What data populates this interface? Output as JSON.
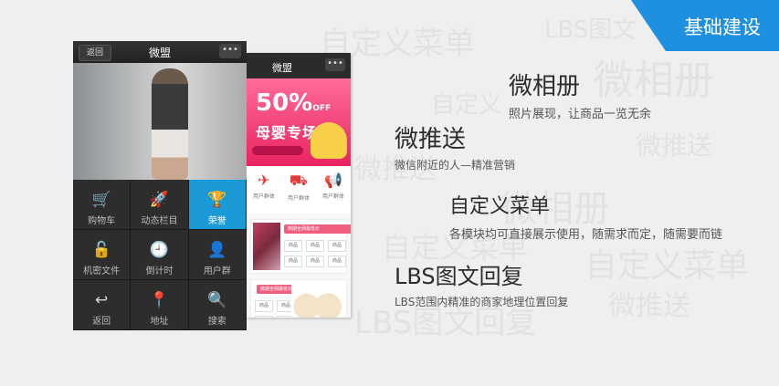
{
  "corner_label": "基础建设",
  "watermarks": [
    "自定义菜单",
    "LBS图文",
    "微相册",
    "自定义",
    "微推送",
    "微相册",
    "自定义菜单",
    "微推送",
    "LBS图文回复",
    "微推送",
    "自定义菜单"
  ],
  "phone_back": {
    "title": "微盟",
    "menu": "•••",
    "banner_percent": "50%",
    "banner_off": "OFF",
    "banner_title": "母婴专场",
    "icons": [
      {
        "icon": "plane-icon",
        "label": "用户群体"
      },
      {
        "icon": "truck-icon",
        "label": "用户群体"
      },
      {
        "icon": "megaphone-icon",
        "label": "用户群体"
      }
    ],
    "card1_tag": "微期全网最低价",
    "card2_tag": "微期全网最低价",
    "product_label": "商品"
  },
  "phone_front": {
    "back_label": "返回",
    "title": "微盟",
    "menu": "•••",
    "grid": [
      {
        "icon": "cart-icon",
        "glyph": "🛒",
        "label": "购物车"
      },
      {
        "icon": "rocket-icon",
        "glyph": "🚀",
        "label": "动态栏目"
      },
      {
        "icon": "trophy-icon",
        "glyph": "🏆",
        "label": "荣誉",
        "selected": true
      },
      {
        "icon": "unlock-icon",
        "glyph": "🔓",
        "label": "机密文件"
      },
      {
        "icon": "clock-icon",
        "glyph": "🕘",
        "label": "倒计时"
      },
      {
        "icon": "user-icon",
        "glyph": "👤",
        "label": "用户群"
      },
      {
        "icon": "reply-icon",
        "glyph": "↩",
        "label": "返回"
      },
      {
        "icon": "location-icon",
        "glyph": "📍",
        "label": "地址"
      },
      {
        "icon": "search-icon",
        "glyph": "🔍",
        "label": "搜索"
      }
    ]
  },
  "features": [
    {
      "title": "微相册",
      "desc": "照片展现，让商品一览无余"
    },
    {
      "title": "微推送",
      "desc": "微信附近的人—精准营销"
    },
    {
      "title": "自定义菜单",
      "desc": "各模块均可直接展示使用，随需求而定，随需要而链"
    },
    {
      "title": "LBS图文回复",
      "desc": "LBS范围内精准的商家地理位置回复"
    }
  ]
}
